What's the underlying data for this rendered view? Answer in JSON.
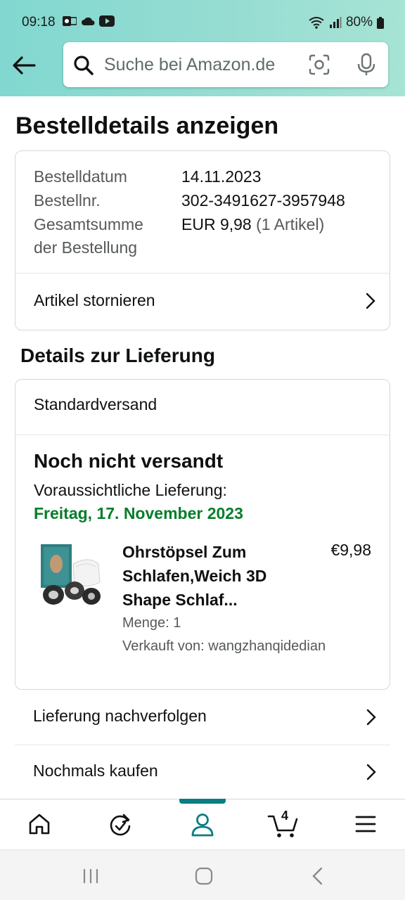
{
  "status_bar": {
    "time": "09:18",
    "battery": "80%"
  },
  "search": {
    "placeholder": "Suche bei Amazon.de"
  },
  "page_title": "Bestelldetails anzeigen",
  "order": {
    "date_label": "Bestelldatum",
    "date": "14.11.2023",
    "number_label": "Bestellnr.",
    "number": "302-3491627-3957948",
    "total_label_1": "Gesamtsumme",
    "total_label_2": "der Bestellung",
    "total": "EUR 9,98",
    "count": "(1 Artikel)",
    "cancel_label": "Artikel stornieren"
  },
  "delivery": {
    "section_title": "Details zur Lieferung",
    "shipping_method": "Standardversand",
    "status": "Noch nicht versandt",
    "expected_label": "Voraussichtliche Lieferung:",
    "expected_date": "Freitag, 17. November 2023",
    "item": {
      "name": "Ohrstöpsel Zum Schlafen,Weich 3D Shape Schlaf...",
      "price": "€9,98",
      "quantity": "Menge: 1",
      "seller": "Verkauft von: wangzhanqidedian"
    }
  },
  "actions": {
    "track": "Lieferung nachverfolgen",
    "buy_again": "Nochmals kaufen"
  },
  "tabbar": {
    "cart_count": "4"
  },
  "colors": {
    "accent": "#0a7d82",
    "delivery_green": "#067d2a",
    "header": "#92dbd2"
  }
}
